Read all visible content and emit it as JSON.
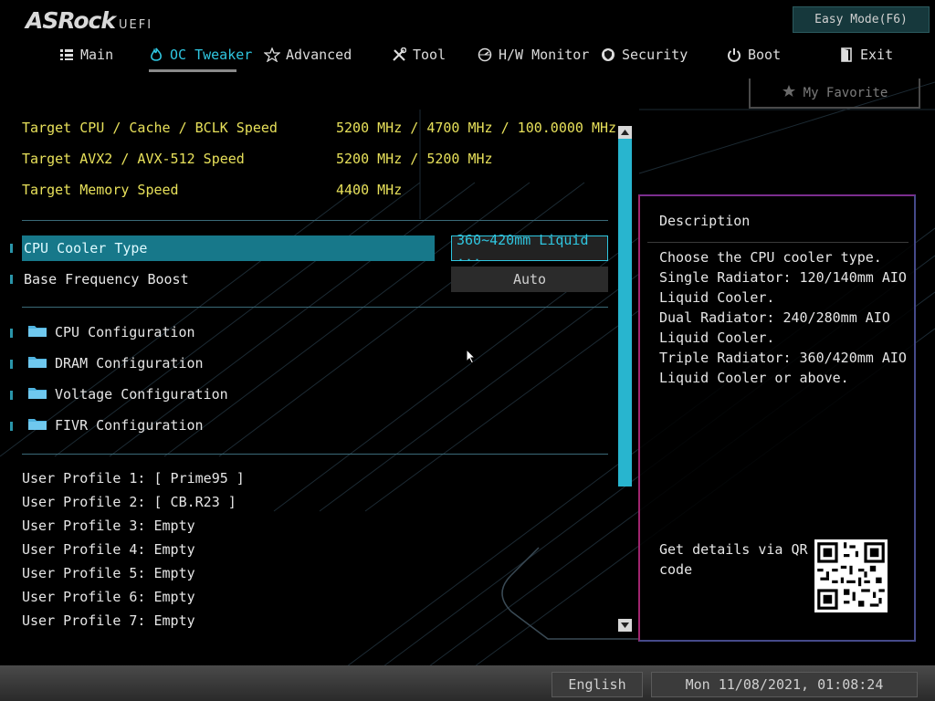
{
  "header": {
    "logo_text": "ASRock",
    "logo_suffix": "UEFI",
    "easy_mode_label": "Easy Mode(F6)"
  },
  "nav": {
    "tabs": [
      {
        "label": "Main",
        "icon": "list-icon"
      },
      {
        "label": "OC Tweaker",
        "icon": "flame-icon",
        "active": true
      },
      {
        "label": "Advanced",
        "icon": "star-icon"
      },
      {
        "label": "Tool",
        "icon": "tools-icon"
      },
      {
        "label": "H/W Monitor",
        "icon": "monitor-gauge-icon"
      },
      {
        "label": "Security",
        "icon": "shield-icon"
      },
      {
        "label": "Boot",
        "icon": "power-icon"
      },
      {
        "label": "Exit",
        "icon": "exit-door-icon"
      }
    ]
  },
  "favorite": {
    "label": "My Favorite",
    "icon": "star-icon"
  },
  "targets": [
    {
      "label": "Target CPU / Cache / BCLK Speed",
      "value": "5200 MHz / 4700 MHz / 100.0000 MHz"
    },
    {
      "label": "Target AVX2 / AVX-512 Speed",
      "value": "5200 MHz / 5200 MHz"
    },
    {
      "label": "Target Memory Speed",
      "value": "4400 MHz"
    }
  ],
  "settings": [
    {
      "label": "CPU Cooler Type",
      "value": "360~420mm Liquid ...",
      "selected": true
    },
    {
      "label": "Base Frequency Boost",
      "value": "Auto"
    }
  ],
  "folders": [
    {
      "label": "CPU Configuration"
    },
    {
      "label": "DRAM Configuration"
    },
    {
      "label": "Voltage Configuration"
    },
    {
      "label": "FIVR Configuration"
    }
  ],
  "profiles": [
    "User Profile 1: [ Prime95 ]",
    "User Profile 2: [ CB.R23 ]",
    "User Profile 3: Empty",
    "User Profile 4: Empty",
    "User Profile 5: Empty",
    "User Profile 6: Empty",
    "User Profile 7: Empty"
  ],
  "description": {
    "title": "Description",
    "lines": [
      "Choose the CPU cooler type.",
      "Single Radiator: 120/140mm AIO",
      "Liquid Cooler.",
      "Dual Radiator: 240/280mm AIO",
      "Liquid Cooler.",
      "Triple Radiator: 360/420mm AIO",
      "Liquid Cooler or above."
    ],
    "qr_text_1": "Get details via QR",
    "qr_text_2": "code"
  },
  "footer": {
    "language": "English",
    "datetime": "Mon 11/08/2021, 01:08:24"
  },
  "colors": {
    "accent": "#2fc6e0",
    "highlight": "#17788a",
    "target_text": "#e7e05a"
  }
}
